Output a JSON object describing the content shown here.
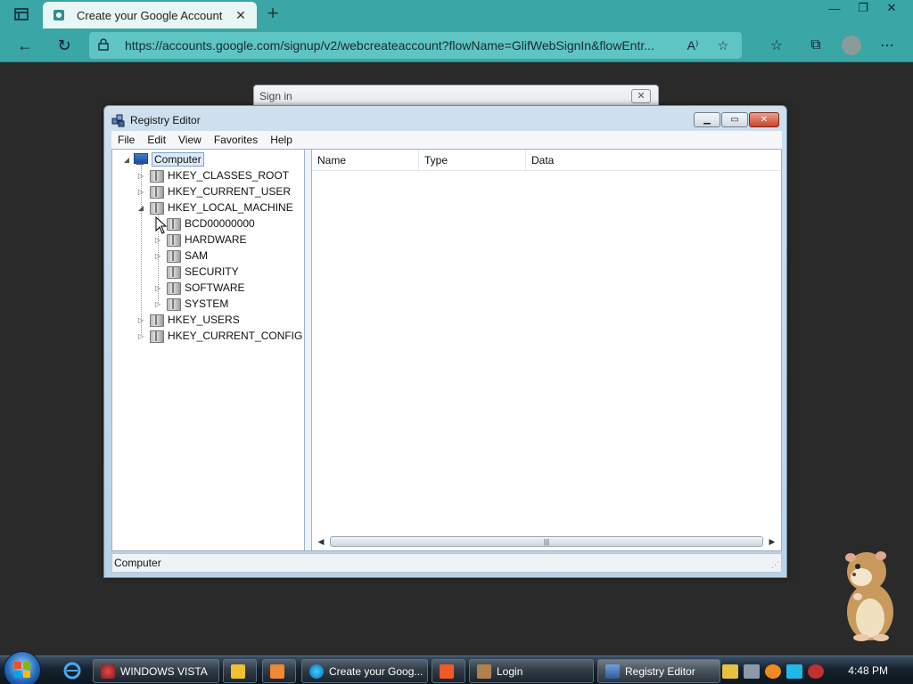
{
  "browser": {
    "tab_title": "Create your Google Account",
    "tab_close": "✕",
    "new_tab": "+",
    "url": "https://accounts.google.com/signup/v2/webcreateaccount?flowName=GlifWebSignIn&flowEntr...",
    "accent_color": "#3aa6a6"
  },
  "signin_dialog": {
    "title": "Sign in",
    "close": "✕"
  },
  "registry_editor": {
    "title": "Registry Editor",
    "menu": [
      "File",
      "Edit",
      "View",
      "Favorites",
      "Help"
    ],
    "tree": {
      "root": "Computer",
      "items": [
        {
          "label": "HKEY_CLASSES_ROOT"
        },
        {
          "label": "HKEY_CURRENT_USER"
        },
        {
          "label": "HKEY_LOCAL_MACHINE"
        },
        {
          "label": "BCD00000000"
        },
        {
          "label": "HARDWARE"
        },
        {
          "label": "SAM"
        },
        {
          "label": "SECURITY"
        },
        {
          "label": "SOFTWARE"
        },
        {
          "label": "SYSTEM"
        },
        {
          "label": "HKEY_USERS"
        },
        {
          "label": "HKEY_CURRENT_CONFIG"
        }
      ]
    },
    "columns": [
      "Name",
      "Type",
      "Data"
    ],
    "status": "Computer"
  },
  "taskbar": {
    "buttons": [
      {
        "label": "WINDOWS VISTA"
      },
      {
        "label": "Create your Goog..."
      },
      {
        "label": "Login"
      },
      {
        "label": "Registry Editor"
      }
    ],
    "clock": "4:48 PM"
  }
}
